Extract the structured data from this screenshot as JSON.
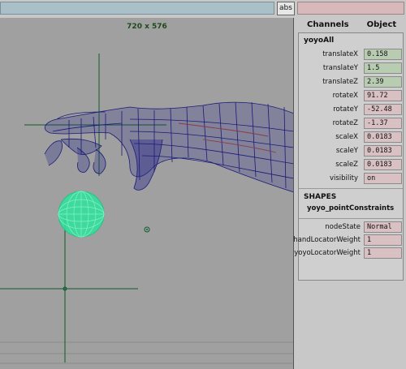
{
  "toolbar": {
    "abs_label": "abs"
  },
  "viewport": {
    "resolution": "720 x 576"
  },
  "channel_box": {
    "menu": [
      "Channels",
      "Object"
    ],
    "object_name": "yoyoAll",
    "attributes": [
      {
        "label": "translateX",
        "value": "0.158",
        "color": "green"
      },
      {
        "label": "translateY",
        "value": "1.5",
        "color": "green"
      },
      {
        "label": "translateZ",
        "value": "2.39",
        "color": "green"
      },
      {
        "label": "rotateX",
        "value": "91.72",
        "color": "pink"
      },
      {
        "label": "rotateY",
        "value": "-52.48",
        "color": "pink"
      },
      {
        "label": "rotateZ",
        "value": "-1.37",
        "color": "pink"
      },
      {
        "label": "scaleX",
        "value": "0.0183",
        "color": "pink"
      },
      {
        "label": "scaleY",
        "value": "0.0183",
        "color": "pink"
      },
      {
        "label": "scaleZ",
        "value": "0.0183",
        "color": "pink"
      },
      {
        "label": "visibility",
        "value": "on",
        "color": "pink"
      }
    ],
    "shapes_header": "SHAPES",
    "shape_name": "yoyo_pointConstraints",
    "shape_attributes": [
      {
        "label": "nodeState",
        "value": "Normal"
      },
      {
        "label": "handLocatorWeight",
        "value": "1"
      },
      {
        "label": "yoyoLocatorWeight",
        "value": "1"
      }
    ]
  },
  "colors": {
    "wireframe": "#1a1a78",
    "yoyo": "#33e6a0",
    "locator": "#0e5a2a",
    "field_green": "#b8ccb2",
    "field_pink": "#d9c0c2"
  }
}
